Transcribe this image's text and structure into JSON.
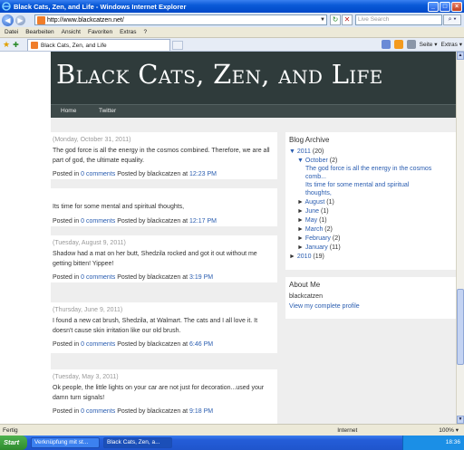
{
  "window": {
    "title": "Black Cats, Zen, and Life - Windows Internet Explorer",
    "minimize": "_",
    "maximize": "□",
    "close": "×"
  },
  "address_bar": {
    "url": "http://www.blackcatzen.net/",
    "search_placeholder": "Live Search",
    "back_glyph": "◀",
    "forward_glyph": "▶",
    "dropdown_glyph": "▼",
    "refresh_glyph": "↻",
    "stop_glyph": "✕",
    "search_button_glyph": "⌕ ▾"
  },
  "menu": [
    "Datei",
    "Bearbeiten",
    "Ansicht",
    "Favoriten",
    "Extras",
    "?"
  ],
  "tabs": [
    {
      "label": "Black Cats, Zen, and Life"
    }
  ],
  "toolbar": {
    "page_label": "Seite ▾",
    "tools_label": "Extras ▾",
    "favorites_star_glyph": "★",
    "add_fav_glyph": "✚"
  },
  "blog": {
    "title": "Black Cats, Zen, and Life",
    "nav": [
      "Home",
      "Twitter"
    ]
  },
  "posts": [
    {
      "date": "(Monday, October 31, 2011)",
      "body": "The god force is all the energy in the cosmos combined. Therefore, we are all part of god, the ultimate equality.",
      "posted_in": "Posted in",
      "comments": "0 comments",
      "posted_by": "Posted by blackcatzen at",
      "time": "12:23 PM"
    },
    {
      "date": "",
      "body": "Its time for some mental and spiritual thoughts,",
      "posted_in": "Posted in",
      "comments": "0 comments",
      "posted_by": "Posted by blackcatzen at",
      "time": "12:17 PM"
    },
    {
      "date": "(Tuesday, August 9, 2011)",
      "body": "Shadow had a mat on her butt, Shedzila rocked and got it out without me getting bitten! Yippee!",
      "posted_in": "Posted in",
      "comments": "0 comments",
      "posted_by": "Posted by blackcatzen at",
      "time": "3:19 PM"
    },
    {
      "date": "(Thursday, June 9, 2011)",
      "body": "I found a new cat brush, Shedzila, at Walmart. The cats and I all love it. It doesn't cause skin irritation like our old brush.",
      "posted_in": "Posted in",
      "comments": "0 comments",
      "posted_by": "Posted by blackcatzen at",
      "time": "6:46 PM"
    },
    {
      "date": "(Tuesday, May 3, 2011)",
      "body": "Ok people, the little lights on your car are not just for decoration...used your damn turn signals!",
      "posted_in": "Posted in",
      "comments": "0 comments",
      "posted_by": "Posted by blackcatzen at",
      "time": "9:18 PM"
    }
  ],
  "sidebar": {
    "archive_title": "Blog Archive",
    "year_2011": {
      "arrow": "▼",
      "label": "2011",
      "count": "(20)"
    },
    "october": {
      "arrow": "▼",
      "label": "October",
      "count": "(2)"
    },
    "october_posts": [
      "The god force is all the energy in the cosmos comb...",
      "Its time for some mental and spiritual thoughts,"
    ],
    "months": [
      {
        "arrow": "►",
        "label": "August",
        "count": "(1)"
      },
      {
        "arrow": "►",
        "label": "June",
        "count": "(1)"
      },
      {
        "arrow": "►",
        "label": "May",
        "count": "(1)"
      },
      {
        "arrow": "►",
        "label": "March",
        "count": "(2)"
      },
      {
        "arrow": "►",
        "label": "February",
        "count": "(2)"
      },
      {
        "arrow": "►",
        "label": "January",
        "count": "(11)"
      }
    ],
    "year_2010": {
      "arrow": "►",
      "label": "2010",
      "count": "(19)"
    },
    "about_title": "About Me",
    "author": "blackcatzen",
    "profile_link": "View my complete profile"
  },
  "status": {
    "text": "Fertig",
    "zone": "Internet",
    "zoom": "100%  ▾"
  },
  "taskbar": {
    "start": "Start",
    "tasks": [
      "Verknüpfung mit st...",
      "Black Cats, Zen, a..."
    ],
    "clock": "18:36"
  },
  "colors": {
    "header_bg": "#2f3b3b",
    "link": "#2a5db0",
    "taskbar": "#245dd8"
  }
}
